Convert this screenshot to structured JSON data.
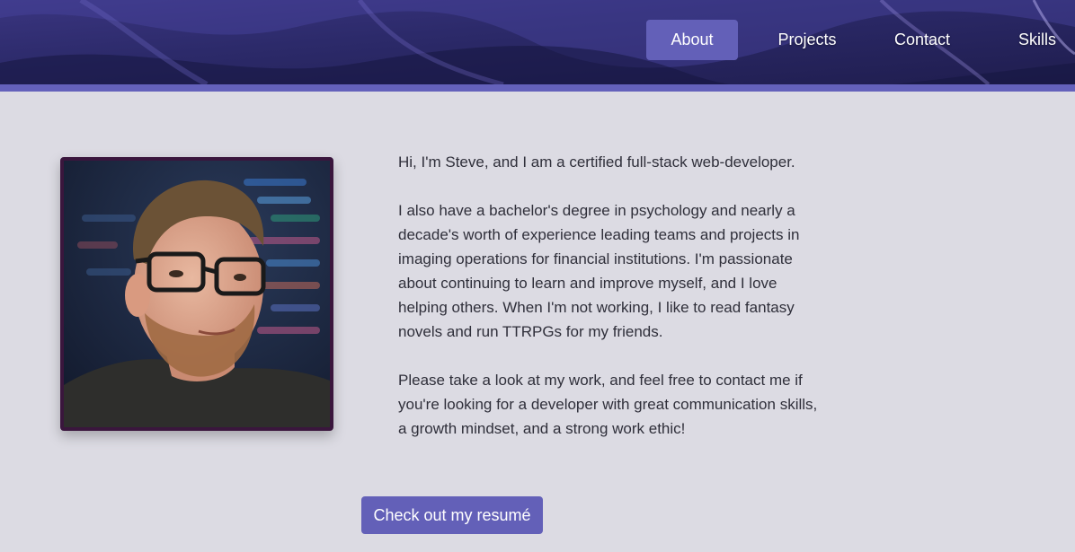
{
  "nav": {
    "items": [
      {
        "label": "About",
        "active": true
      },
      {
        "label": "Projects",
        "active": false
      },
      {
        "label": "Contact",
        "active": false
      },
      {
        "label": "Skills",
        "active": false
      }
    ]
  },
  "about": {
    "paragraphs": [
      "Hi, I'm Steve, and I am a certified full-stack web-developer.",
      "I also have a bachelor's degree in psychology and nearly a decade's worth of experience leading teams and projects in imaging operations for financial institutions. I'm passionate about continuing to learn and improve myself, and I love helping others. When I'm not working, I like to read fantasy novels and run TTRPGs for my friends.",
      "Please take a look at my work, and feel free to contact me if you're looking for a developer with great communication skills, a growth mindset, and a strong work ethic!"
    ],
    "resume_label": "Check out my resumé"
  },
  "colors": {
    "accent": "#6360b8",
    "page_background": "#dcdbe3",
    "photo_border": "#3a163d"
  }
}
